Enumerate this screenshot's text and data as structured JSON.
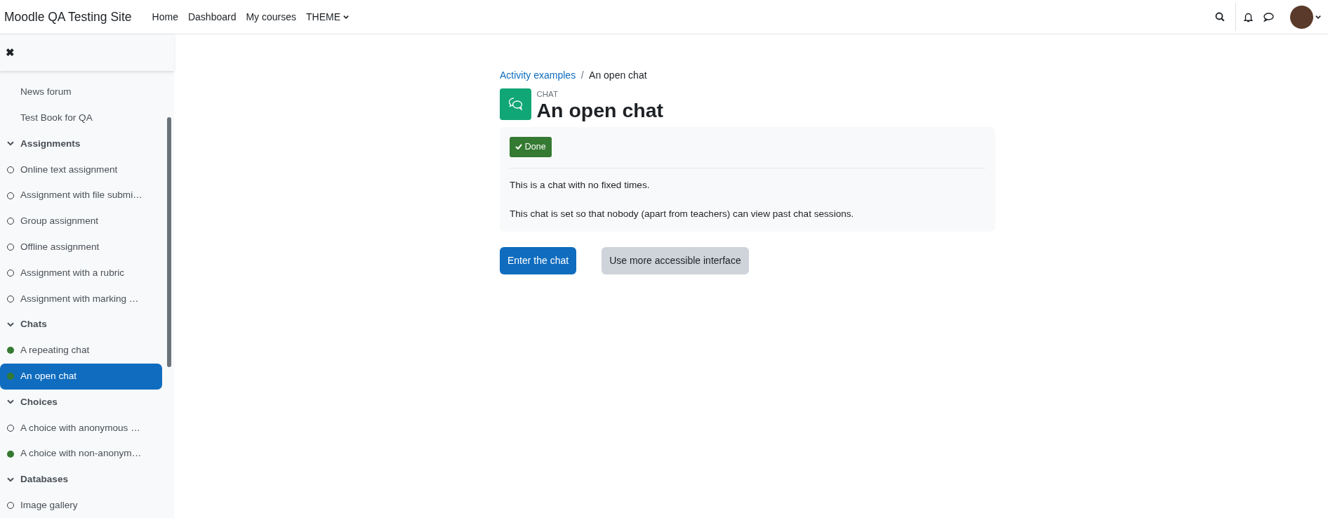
{
  "navbar": {
    "site_name": "Moodle QA Testing Site",
    "links": [
      {
        "label": "Home",
        "dropdown": false
      },
      {
        "label": "Dashboard",
        "dropdown": false
      },
      {
        "label": "My courses",
        "dropdown": false
      },
      {
        "label": "THEME",
        "dropdown": true
      }
    ]
  },
  "drawer": {
    "close_label": "✖",
    "items": [
      {
        "kind": "activity",
        "title": "News forum",
        "selected": false
      },
      {
        "kind": "activity",
        "title": "Test Book for QA",
        "selected": false
      },
      {
        "kind": "section",
        "title": "Assignments",
        "expanded": true,
        "children": [
          {
            "kind": "activity",
            "title": "Online text assignment",
            "completed": false,
            "selected": false
          },
          {
            "kind": "activity",
            "title": "Assignment with file submi…",
            "completed": false,
            "selected": false
          },
          {
            "kind": "activity",
            "title": "Group assignment",
            "completed": false,
            "selected": false
          },
          {
            "kind": "activity",
            "title": "Offline assignment",
            "completed": false,
            "selected": false
          },
          {
            "kind": "activity",
            "title": "Assignment with a rubric",
            "completed": false,
            "selected": false
          },
          {
            "kind": "activity",
            "title": "Assignment with marking …",
            "completed": false,
            "selected": false
          }
        ]
      },
      {
        "kind": "section",
        "title": "Chats",
        "expanded": true,
        "children": [
          {
            "kind": "activity",
            "title": "A repeating chat",
            "completed": true,
            "selected": false
          },
          {
            "kind": "activity",
            "title": "An open chat",
            "completed": true,
            "selected": true
          }
        ]
      },
      {
        "kind": "section",
        "title": "Choices",
        "expanded": true,
        "children": [
          {
            "kind": "activity",
            "title": "A choice with anonymous …",
            "completed": false,
            "selected": false
          },
          {
            "kind": "activity",
            "title": "A choice with non-anonym…",
            "completed": true,
            "selected": false
          }
        ]
      },
      {
        "kind": "section",
        "title": "Databases",
        "expanded": true,
        "children": [
          {
            "kind": "activity",
            "title": "Image gallery",
            "completed": false,
            "selected": false
          }
        ]
      }
    ]
  },
  "breadcrumb": {
    "separator": "/",
    "items": [
      {
        "label": "Activity examples",
        "link": true
      },
      {
        "label": "An open chat",
        "link": false
      }
    ]
  },
  "page_header": {
    "module_type": "CHAT",
    "title": "An open chat"
  },
  "activity_info": {
    "completion_button": {
      "label": "Done",
      "done": true
    },
    "description": [
      "This is a chat with no fixed times.",
      "This chat is set so that nobody (apart from teachers) can view past chat sessions."
    ]
  },
  "actions": [
    {
      "label": "Enter the chat",
      "kind": "primary"
    },
    {
      "label": "Use more accessible interface",
      "kind": "secondary"
    }
  ]
}
